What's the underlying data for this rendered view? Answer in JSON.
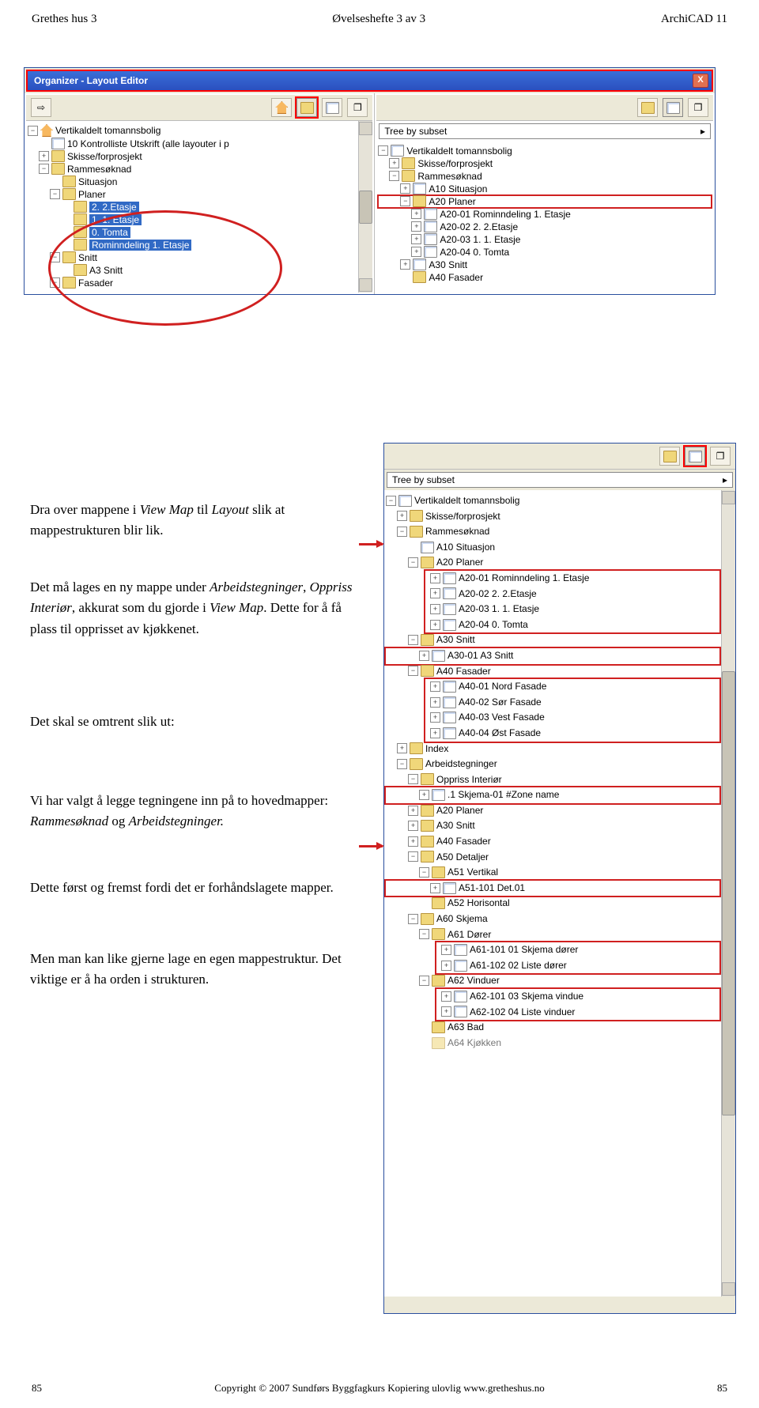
{
  "header": {
    "left": "Grethes hus 3",
    "center": "Øvelseshefte 3 av 3",
    "right": "ArchiCAD 11"
  },
  "organizer": {
    "title": "Organizer - Layout Editor",
    "close_label": "X",
    "left_pane": {
      "root": "Vertikaldelt tomannsbolig",
      "items": [
        "10 Kontrolliste Utskrift (alle layouter i p",
        "Skisse/forprosjekt",
        "Rammesøknad",
        "Situasjon",
        "Planer",
        "2. 2.Etasje",
        "1. 1. Etasje",
        "0. Tomta",
        "Rominndeling 1. Etasje",
        "Snitt",
        "A3 Snitt",
        "Fasader"
      ]
    },
    "right_pane": {
      "dropdown": "Tree by subset",
      "root": "Vertikaldelt tomannsbolig",
      "items": [
        "Skisse/forprosjekt",
        "Rammesøknad",
        "A10 Situasjon",
        "A20 Planer",
        "A20-01 Rominndeling 1. Etasje",
        "A20-02 2. 2.Etasje",
        "A20-03 1. 1. Etasje",
        "A20-04 0. Tomta",
        "A30 Snitt",
        "A40 Fasader"
      ]
    }
  },
  "organizer2": {
    "dropdown": "Tree by subset",
    "root": "Vertikaldelt tomannsbolig",
    "items": {
      "skisse": "Skisse/forprosjekt",
      "ramme": "Rammesøknad",
      "a10": "A10 Situasjon",
      "a20": "A20 Planer",
      "a20_01": "A20-01 Rominndeling 1. Etasje",
      "a20_02": "A20-02 2. 2.Etasje",
      "a20_03": "A20-03 1. 1. Etasje",
      "a20_04": "A20-04 0. Tomta",
      "a30": "A30 Snitt",
      "a30_01": "A30-01 A3 Snitt",
      "a40": "A40 Fasader",
      "a40_01": "A40-01 Nord Fasade",
      "a40_02": "A40-02 Sør Fasade",
      "a40_03": "A40-03 Vest Fasade",
      "a40_04": "A40-04 Øst Fasade",
      "index": "Index",
      "arbeid": "Arbeidstegninger",
      "oppriss": "Oppriss Interiør",
      "skjema01": ".1 Skjema-01 #Zone name",
      "a20b": "A20 Planer",
      "a30b": "A30 Snitt",
      "a40b": "A40 Fasader",
      "a50": "A50 Detaljer",
      "a51": "A51 Vertikal",
      "a51_101": "A51-101 Det.01",
      "a52": "A52 Horisontal",
      "a60": "A60 Skjema",
      "a61": "A61 Dører",
      "a61_101": "A61-101 01 Skjema dører",
      "a61_102": "A61-102 02 Liste dører",
      "a62": "A62 Vinduer",
      "a62_101": "A62-101 03 Skjema vindue",
      "a62_102": "A62-102 04 Liste vinduer",
      "a63": "A63 Bad",
      "a64": "A64 Kjøkken"
    }
  },
  "body": {
    "p1a": "Dra over mappene i ",
    "p1i": "View Map",
    "p1b": " til ",
    "p1c": "Layout",
    "p1d": " slik at mappestrukturen blir lik.",
    "p2a": "Det må lages en ny mappe under ",
    "p2b": "Arbeidstegninger",
    "p2c": ", ",
    "p2d": "Oppriss Interiør",
    "p2e": ", akkurat som du gjorde i ",
    "p2f": "View Map",
    "p2g": ". Dette for å få plass til opprisset av kjøkkenet.",
    "p3": "Det skal se omtrent slik ut:",
    "p4a": "Vi har valgt å legge tegningene inn på to hovedmapper:",
    "p4b": "Rammesøknad",
    "p4c": " og ",
    "p4d": "Arbeidstegninger.",
    "p5": "Dette først og fremst fordi det er forhåndslagete mapper.",
    "p6": "Men man kan like gjerne lage en egen mappestruktur. Det viktige er å ha orden i strukturen."
  },
  "footer": {
    "page_left": "85",
    "copyright": "Copyright © 2007   Sundførs Byggfagkurs    Kopiering ulovlig   www.gretheshus.no",
    "page_right": "85"
  }
}
